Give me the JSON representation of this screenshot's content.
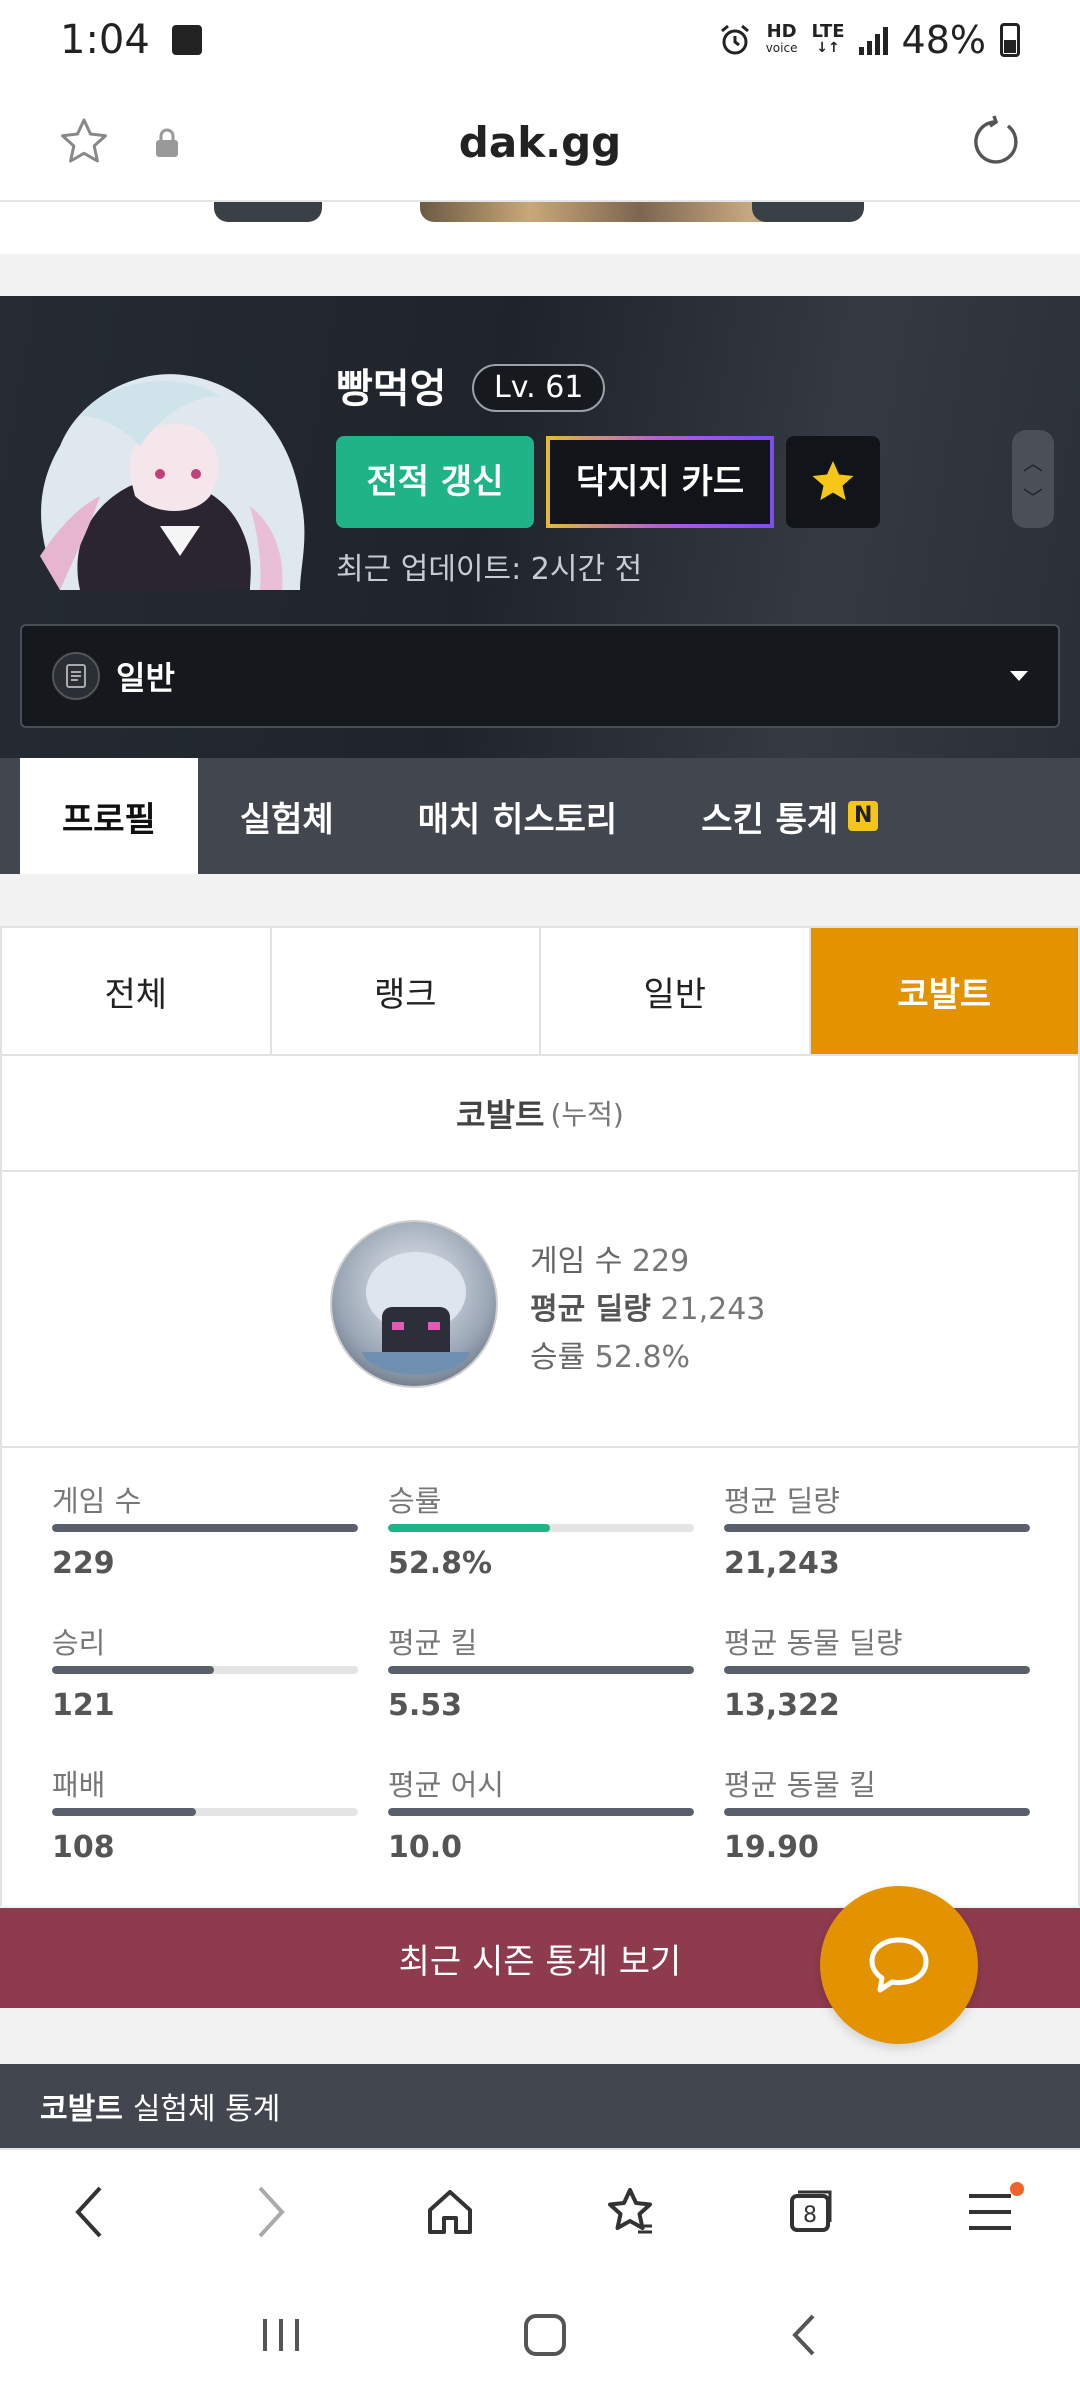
{
  "status_bar": {
    "time": "1:04",
    "hd_label": "HD",
    "voice_label": "voice",
    "lte_label": "LTE",
    "battery_text": "48%"
  },
  "url_bar": {
    "domain": "dak.gg"
  },
  "profile": {
    "name": "빵먹엉",
    "level": "Lv. 61",
    "refresh_label": "전적 갱신",
    "card_label": "닥지지 카드",
    "last_update": "최근 업데이트: 2시간 전",
    "mode_label": "일반"
  },
  "main_tabs": [
    {
      "label": "프로필"
    },
    {
      "label": "실험체"
    },
    {
      "label": "매치 히스토리"
    },
    {
      "label": "스킨 통계",
      "badge": "N"
    }
  ],
  "sub_tabs": [
    {
      "label": "전체"
    },
    {
      "label": "랭크"
    },
    {
      "label": "일반"
    },
    {
      "label": "코발트"
    }
  ],
  "summary": {
    "title": "코발트",
    "title_sub": "(누적)",
    "games_label": "게임 수",
    "games_value": "229",
    "damage_label": "평균 딜량",
    "damage_value": "21,243",
    "winrate_label": "승률",
    "winrate_value": "52.8%"
  },
  "stats": [
    {
      "label": "게임 수",
      "value": "229",
      "fill": 1.0,
      "color": "#5a5f6c"
    },
    {
      "label": "승률",
      "value": "52.8%",
      "fill": 0.528,
      "color": "#1fb487"
    },
    {
      "label": "평균 딜량",
      "value": "21,243",
      "fill": 1.0,
      "color": "#5a5f6c"
    },
    {
      "label": "승리",
      "value": "121",
      "fill": 0.528,
      "color": "#5a5f6c"
    },
    {
      "label": "평균 킬",
      "value": "5.53",
      "fill": 1.0,
      "color": "#5a5f6c"
    },
    {
      "label": "평균 동물 딜량",
      "value": "13,322",
      "fill": 1.0,
      "color": "#5a5f6c"
    },
    {
      "label": "패배",
      "value": "108",
      "fill": 0.472,
      "color": "#5a5f6c"
    },
    {
      "label": "평균 어시",
      "value": "10.0",
      "fill": 1.0,
      "color": "#5a5f6c"
    },
    {
      "label": "평균 동물 킬",
      "value": "19.90",
      "fill": 1.0,
      "color": "#5a5f6c"
    }
  ],
  "season_button": "최근 시즌 통계 보기",
  "section_header": {
    "bold": "코발트",
    "rest": "실험체 통계"
  },
  "browser_nav": {
    "tab_count": "8"
  },
  "colors": {
    "accent_orange": "#e39200",
    "accent_green": "#1fb487",
    "season_button": "#8e3b4e",
    "tab_dark": "#41464f"
  }
}
